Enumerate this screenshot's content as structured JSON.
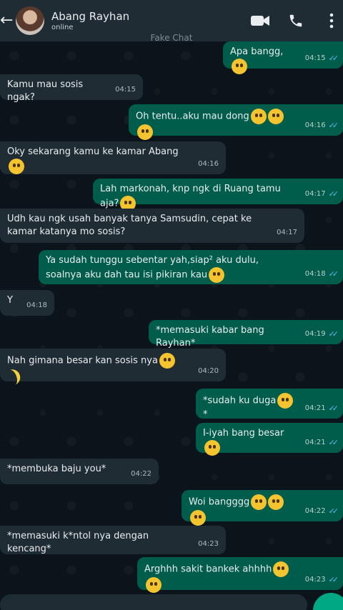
{
  "header": {
    "contact_name": "Abang Rayhan",
    "status": "online"
  },
  "watermark": "Fake Chat",
  "messages": [
    {
      "dir": "out",
      "text": "Apa bangg,",
      "emoji": [
        "rolling-eyes"
      ],
      "time": "04:15",
      "ticks": true
    },
    {
      "dir": "in",
      "text": "Kamu mau sosis ngak?",
      "time": "04:15"
    },
    {
      "dir": "out",
      "text": "Oh tentu..aku mau dong",
      "emoji": [
        "smile",
        "smile",
        "smile"
      ],
      "time": "04:16",
      "ticks": true
    },
    {
      "dir": "in",
      "text": "Oky sekarang kamu ke kamar Abang",
      "emoji": [
        "grin"
      ],
      "time": "04:16"
    },
    {
      "dir": "out",
      "text": "Lah markonah, knp ngk di Ruang tamu aja?",
      "emoji": [
        "raised-eyebrow"
      ],
      "time": "04:17",
      "ticks": true
    },
    {
      "dir": "in",
      "text": "Udh kau ngk usah banyak tanya Samsudin, cepat ke kamar katanya mo sosis?",
      "time": "04:17"
    },
    {
      "dir": "out",
      "text": "Ya sudah tunggu sebentar yah,siap² aku dulu, soalnya aku dah tau isi pikiran kau",
      "emoji": [
        "confused"
      ],
      "time": "04:18",
      "ticks": true
    },
    {
      "dir": "in",
      "text": "Y",
      "time": "04:18"
    },
    {
      "dir": "out",
      "text": "*memasuki kabar bang Rayhan*",
      "time": "04:19",
      "ticks": true
    },
    {
      "dir": "in",
      "text": "Nah gimana besar kan sosis nya",
      "emoji": [
        "smile",
        "banana"
      ],
      "time": "04:20"
    },
    {
      "dir": "out",
      "text": "*sudah ku duga",
      "emoji": [
        "anxious"
      ],
      "suffix": "*",
      "time": "04:21",
      "ticks": true
    },
    {
      "dir": "out",
      "text": "I-iyah bang besar",
      "emoji": [
        "crying"
      ],
      "time": "04:21",
      "ticks": true
    },
    {
      "dir": "in",
      "text": "*membuka baju you*",
      "time": "04:22"
    },
    {
      "dir": "out",
      "text": "Woi bangggg",
      "emoji": [
        "crying",
        "crying",
        "crying"
      ],
      "time": "04:22",
      "ticks": true
    },
    {
      "dir": "in",
      "text": "*memasuki k*ntol nya dengan kencang*",
      "time": "04:23"
    },
    {
      "dir": "out",
      "text": "Arghhh sakit bankek ahhhh",
      "emoji": [
        "anxious",
        "crying"
      ],
      "time": "04:23",
      "ticks": true
    }
  ],
  "colors": {
    "header_bg": "#1f2c34",
    "incoming_bubble": "#1f2c34",
    "outgoing_bubble": "#005c4b",
    "read_ticks": "#53bdeb"
  }
}
